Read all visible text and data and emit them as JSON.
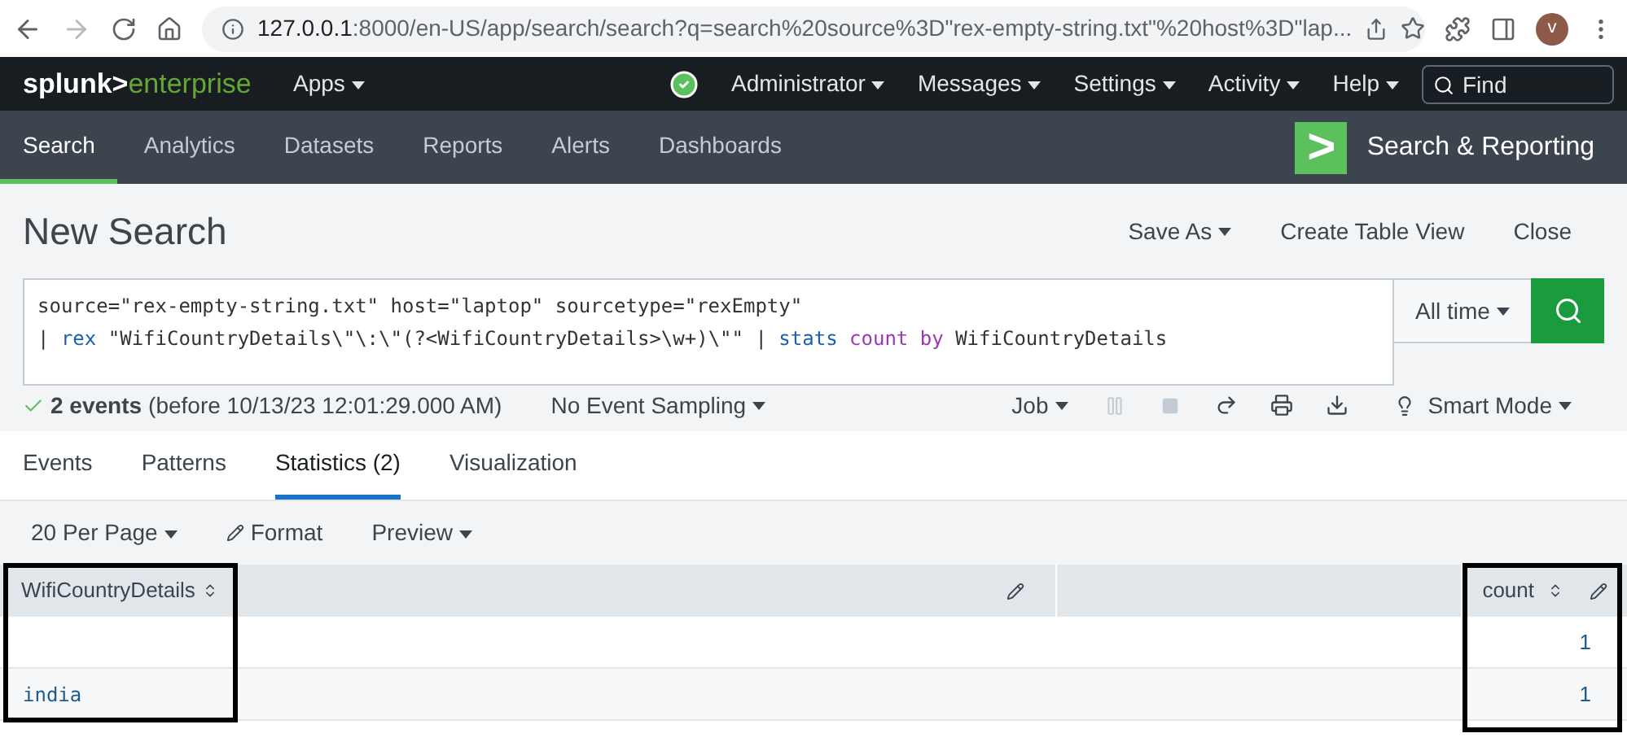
{
  "browser": {
    "url_host": "127.0.0.1",
    "url_rest": ":8000/en-US/app/search/search?q=search%20source%3D\"rex-empty-string.txt\"%20host%3D\"lap...",
    "profile_initial": "v"
  },
  "top_bar": {
    "logo_left": "splunk>",
    "logo_right": "enterprise",
    "apps": "Apps",
    "menus": [
      "Administrator",
      "Messages",
      "Settings",
      "Activity",
      "Help"
    ],
    "find_placeholder": "Find"
  },
  "app_bar": {
    "tabs": [
      {
        "label": "Search",
        "selected": true
      },
      {
        "label": "Analytics",
        "selected": false
      },
      {
        "label": "Datasets",
        "selected": false
      },
      {
        "label": "Reports",
        "selected": false
      },
      {
        "label": "Alerts",
        "selected": false
      },
      {
        "label": "Dashboards",
        "selected": false
      }
    ],
    "logo_glyph": ">",
    "app_name": "Search & Reporting"
  },
  "header": {
    "title": "New Search",
    "actions": [
      {
        "label": "Save As",
        "dropdown": true
      },
      {
        "label": "Create Table View",
        "dropdown": false
      },
      {
        "label": "Close",
        "dropdown": false
      }
    ]
  },
  "query": {
    "lines": [
      [
        {
          "kind": "text",
          "text": "source=\"rex-empty-string.txt\" host=\"laptop\" sourcetype=\"rexEmpty\""
        }
      ],
      [
        {
          "kind": "text",
          "text": "| "
        },
        {
          "kind": "command",
          "text": "rex"
        },
        {
          "kind": "text",
          "text": " \"WifiCountryDetails\\\"\\:\\\"(?<WifiCountryDetails>\\w+)\\\"\" | "
        },
        {
          "kind": "command",
          "text": "stats"
        },
        {
          "kind": "function",
          "text": " count"
        },
        {
          "kind": "keyword",
          "text": " by"
        },
        {
          "kind": "text",
          "text": " WifiCountryDetails"
        }
      ]
    ],
    "time_range": "All time"
  },
  "status": {
    "events": "2 events",
    "before": "(before 10/13/23 12:01:29.000 AM)",
    "sampling": "No Event Sampling",
    "job": "Job",
    "mode": "Smart Mode"
  },
  "result_tabs": [
    {
      "label": "Events",
      "selected": false
    },
    {
      "label": "Patterns",
      "selected": false
    },
    {
      "label": "Statistics (2)",
      "selected": true
    },
    {
      "label": "Visualization",
      "selected": false
    }
  ],
  "toolbar": {
    "per_page": "20 Per Page",
    "format": "Format",
    "preview": "Preview"
  },
  "table": {
    "columns": [
      "WifiCountryDetails",
      "count"
    ],
    "rows": [
      {
        "cells": [
          "",
          "1"
        ]
      },
      {
        "cells": [
          "india",
          "1"
        ]
      }
    ]
  }
}
